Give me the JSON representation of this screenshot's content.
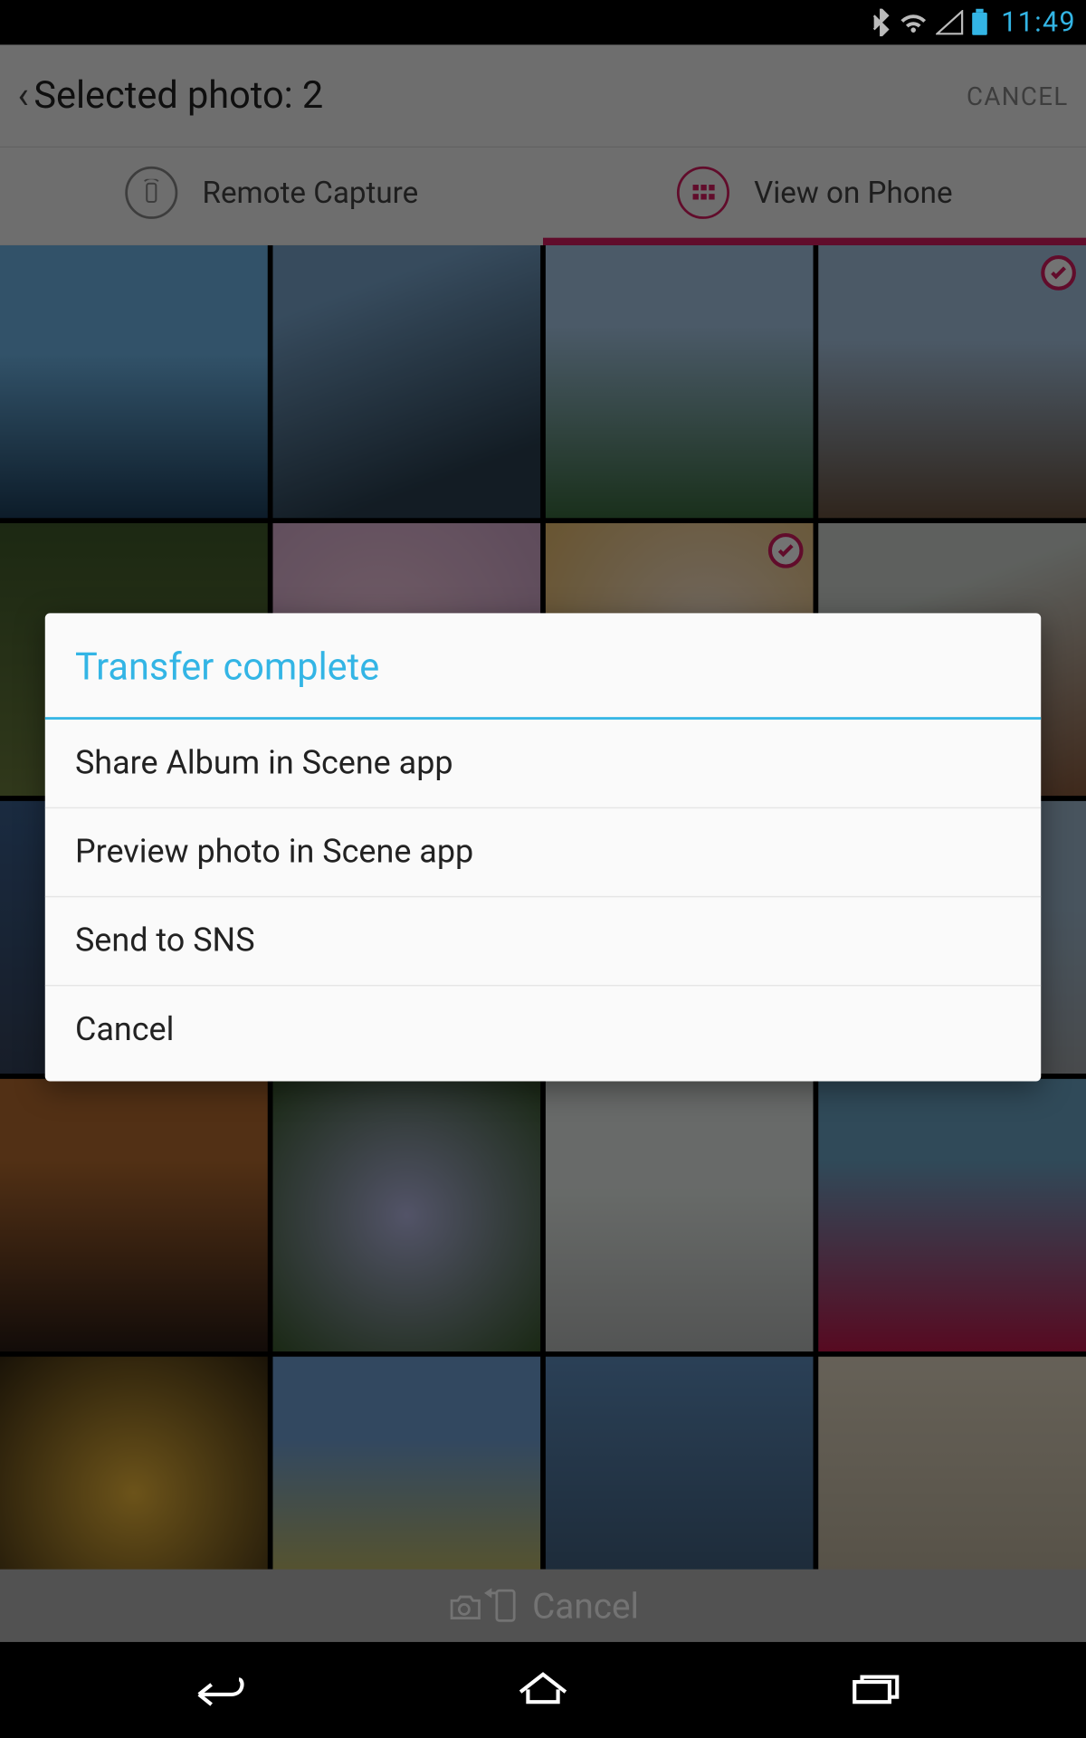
{
  "status": {
    "time": "11:49"
  },
  "header": {
    "title": "Selected photo: 2",
    "cancel": "CANCEL"
  },
  "tabs": {
    "remote": "Remote Capture",
    "view": "View on Phone"
  },
  "bottomBar": {
    "label": "Cancel"
  },
  "thumbs": [
    {
      "cls": "g1",
      "sel": false
    },
    {
      "cls": "g2",
      "sel": false
    },
    {
      "cls": "g3",
      "sel": false
    },
    {
      "cls": "g4",
      "sel": true
    },
    {
      "cls": "g5",
      "sel": false
    },
    {
      "cls": "g6",
      "sel": false
    },
    {
      "cls": "g7",
      "sel": true
    },
    {
      "cls": "g8",
      "sel": false
    },
    {
      "cls": "g9",
      "sel": false
    },
    {
      "cls": "g10",
      "sel": false
    },
    {
      "cls": "g11",
      "sel": false
    },
    {
      "cls": "g12",
      "sel": false
    },
    {
      "cls": "g13",
      "sel": false
    },
    {
      "cls": "g14",
      "sel": false
    },
    {
      "cls": "g15",
      "sel": false
    },
    {
      "cls": "g16",
      "sel": false
    },
    {
      "cls": "g17",
      "sel": false
    },
    {
      "cls": "g18",
      "sel": false
    },
    {
      "cls": "g19",
      "sel": false
    },
    {
      "cls": "g20",
      "sel": false
    }
  ],
  "dialog": {
    "title": "Transfer complete",
    "options": [
      "Share Album in Scene app",
      "Preview photo in Scene app",
      "Send to SNS",
      "Cancel"
    ]
  }
}
